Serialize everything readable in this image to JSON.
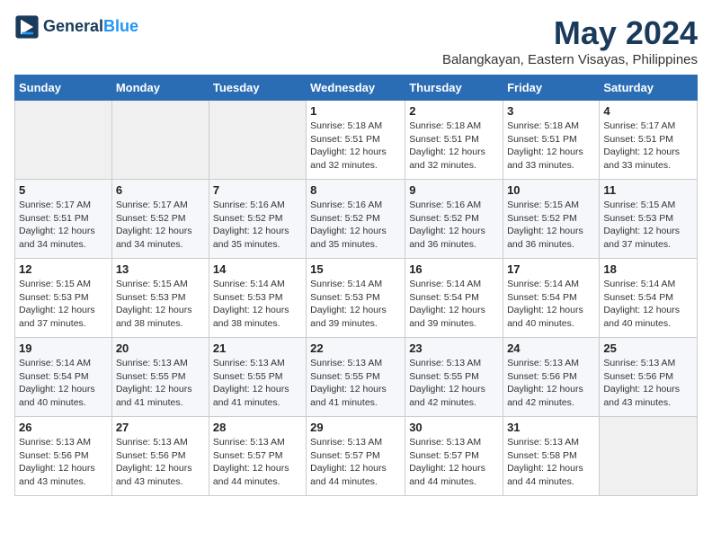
{
  "logo": {
    "line1": "General",
    "line2": "Blue",
    "icon": "▶"
  },
  "title": "May 2024",
  "subtitle": "Balangkayan, Eastern Visayas, Philippines",
  "days_header": [
    "Sunday",
    "Monday",
    "Tuesday",
    "Wednesday",
    "Thursday",
    "Friday",
    "Saturday"
  ],
  "weeks": [
    [
      {
        "day": "",
        "info": ""
      },
      {
        "day": "",
        "info": ""
      },
      {
        "day": "",
        "info": ""
      },
      {
        "day": "1",
        "info": "Sunrise: 5:18 AM\nSunset: 5:51 PM\nDaylight: 12 hours\nand 32 minutes."
      },
      {
        "day": "2",
        "info": "Sunrise: 5:18 AM\nSunset: 5:51 PM\nDaylight: 12 hours\nand 32 minutes."
      },
      {
        "day": "3",
        "info": "Sunrise: 5:18 AM\nSunset: 5:51 PM\nDaylight: 12 hours\nand 33 minutes."
      },
      {
        "day": "4",
        "info": "Sunrise: 5:17 AM\nSunset: 5:51 PM\nDaylight: 12 hours\nand 33 minutes."
      }
    ],
    [
      {
        "day": "5",
        "info": "Sunrise: 5:17 AM\nSunset: 5:51 PM\nDaylight: 12 hours\nand 34 minutes."
      },
      {
        "day": "6",
        "info": "Sunrise: 5:17 AM\nSunset: 5:52 PM\nDaylight: 12 hours\nand 34 minutes."
      },
      {
        "day": "7",
        "info": "Sunrise: 5:16 AM\nSunset: 5:52 PM\nDaylight: 12 hours\nand 35 minutes."
      },
      {
        "day": "8",
        "info": "Sunrise: 5:16 AM\nSunset: 5:52 PM\nDaylight: 12 hours\nand 35 minutes."
      },
      {
        "day": "9",
        "info": "Sunrise: 5:16 AM\nSunset: 5:52 PM\nDaylight: 12 hours\nand 36 minutes."
      },
      {
        "day": "10",
        "info": "Sunrise: 5:15 AM\nSunset: 5:52 PM\nDaylight: 12 hours\nand 36 minutes."
      },
      {
        "day": "11",
        "info": "Sunrise: 5:15 AM\nSunset: 5:53 PM\nDaylight: 12 hours\nand 37 minutes."
      }
    ],
    [
      {
        "day": "12",
        "info": "Sunrise: 5:15 AM\nSunset: 5:53 PM\nDaylight: 12 hours\nand 37 minutes."
      },
      {
        "day": "13",
        "info": "Sunrise: 5:15 AM\nSunset: 5:53 PM\nDaylight: 12 hours\nand 38 minutes."
      },
      {
        "day": "14",
        "info": "Sunrise: 5:14 AM\nSunset: 5:53 PM\nDaylight: 12 hours\nand 38 minutes."
      },
      {
        "day": "15",
        "info": "Sunrise: 5:14 AM\nSunset: 5:53 PM\nDaylight: 12 hours\nand 39 minutes."
      },
      {
        "day": "16",
        "info": "Sunrise: 5:14 AM\nSunset: 5:54 PM\nDaylight: 12 hours\nand 39 minutes."
      },
      {
        "day": "17",
        "info": "Sunrise: 5:14 AM\nSunset: 5:54 PM\nDaylight: 12 hours\nand 40 minutes."
      },
      {
        "day": "18",
        "info": "Sunrise: 5:14 AM\nSunset: 5:54 PM\nDaylight: 12 hours\nand 40 minutes."
      }
    ],
    [
      {
        "day": "19",
        "info": "Sunrise: 5:14 AM\nSunset: 5:54 PM\nDaylight: 12 hours\nand 40 minutes."
      },
      {
        "day": "20",
        "info": "Sunrise: 5:13 AM\nSunset: 5:55 PM\nDaylight: 12 hours\nand 41 minutes."
      },
      {
        "day": "21",
        "info": "Sunrise: 5:13 AM\nSunset: 5:55 PM\nDaylight: 12 hours\nand 41 minutes."
      },
      {
        "day": "22",
        "info": "Sunrise: 5:13 AM\nSunset: 5:55 PM\nDaylight: 12 hours\nand 41 minutes."
      },
      {
        "day": "23",
        "info": "Sunrise: 5:13 AM\nSunset: 5:55 PM\nDaylight: 12 hours\nand 42 minutes."
      },
      {
        "day": "24",
        "info": "Sunrise: 5:13 AM\nSunset: 5:56 PM\nDaylight: 12 hours\nand 42 minutes."
      },
      {
        "day": "25",
        "info": "Sunrise: 5:13 AM\nSunset: 5:56 PM\nDaylight: 12 hours\nand 43 minutes."
      }
    ],
    [
      {
        "day": "26",
        "info": "Sunrise: 5:13 AM\nSunset: 5:56 PM\nDaylight: 12 hours\nand 43 minutes."
      },
      {
        "day": "27",
        "info": "Sunrise: 5:13 AM\nSunset: 5:56 PM\nDaylight: 12 hours\nand 43 minutes."
      },
      {
        "day": "28",
        "info": "Sunrise: 5:13 AM\nSunset: 5:57 PM\nDaylight: 12 hours\nand 44 minutes."
      },
      {
        "day": "29",
        "info": "Sunrise: 5:13 AM\nSunset: 5:57 PM\nDaylight: 12 hours\nand 44 minutes."
      },
      {
        "day": "30",
        "info": "Sunrise: 5:13 AM\nSunset: 5:57 PM\nDaylight: 12 hours\nand 44 minutes."
      },
      {
        "day": "31",
        "info": "Sunrise: 5:13 AM\nSunset: 5:58 PM\nDaylight: 12 hours\nand 44 minutes."
      },
      {
        "day": "",
        "info": ""
      }
    ]
  ]
}
